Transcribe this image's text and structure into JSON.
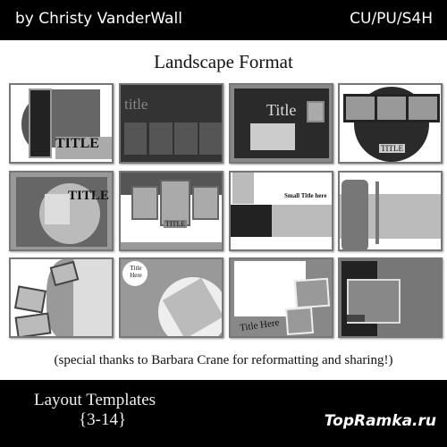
{
  "header": {
    "author": "by Christy VanderWall",
    "license": "CU/PU/S4H"
  },
  "heading": "Landscape Format",
  "thumbnails": [
    {
      "title": "TITLE"
    },
    {
      "title": "title"
    },
    {
      "title": "Title"
    },
    {
      "title": "TITLE"
    },
    {
      "title": "TITLE"
    },
    {
      "title": "TITLE"
    },
    {
      "title": "Small Title here"
    },
    {
      "title": ""
    },
    {
      "title": ""
    },
    {
      "title": "Title Here"
    },
    {
      "title": "Title Here"
    },
    {
      "title": ""
    }
  ],
  "caption": "(special thanks to Barbara Crane for reformatting and sharing!)",
  "footer": {
    "line1": "Layout Templates",
    "line2": "{3-14}",
    "watermark": "TopRamka.ru"
  }
}
